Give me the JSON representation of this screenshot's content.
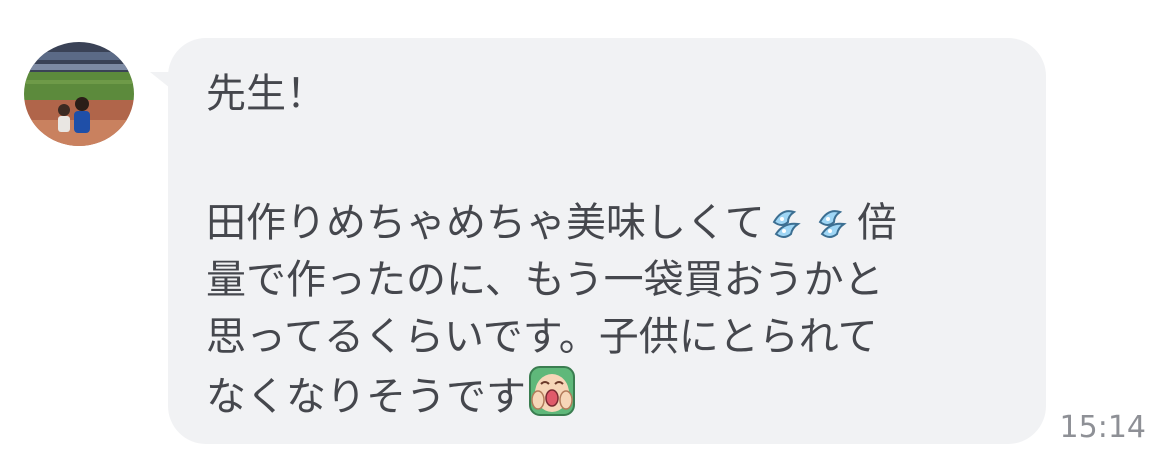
{
  "message": {
    "greeting": "先生！",
    "line1_text": "田作りめちゃめちゃ美味しくて",
    "line1_end": "倍",
    "line2": "量で作ったのに、もう一袋買おうかと",
    "line3": "思ってるくらいです。子供にとられて",
    "line4_text": "なくなりそうです",
    "emojis": [
      "sweat-drops-icon",
      "sweat-drops-icon",
      "screaming-face-sticker-icon"
    ]
  },
  "timestamp": "15:14",
  "colors": {
    "bubble": "#f1f2f4",
    "text": "#45474d",
    "timestamp": "#8e9096"
  }
}
